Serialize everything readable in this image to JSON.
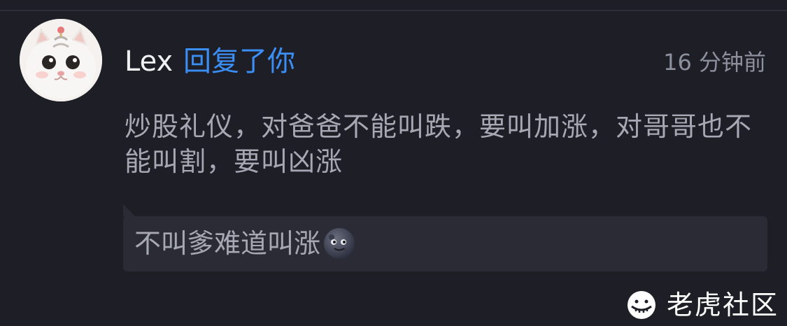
{
  "comment": {
    "username": "Lex",
    "action": "回复了你",
    "time": "16 分钟前",
    "body": "炒股礼仪，对爸爸不能叫跌，要叫加涨，对哥哥也不能叫割，要叫凶涨",
    "quote": "不叫爹难道叫涨",
    "quote_emoji": "new-moon-face-icon"
  },
  "watermark": {
    "text": "老虎社区",
    "icon": "tiger-logo-icon"
  },
  "colors": {
    "background": "#1d1e26",
    "accent": "#3b8ff4",
    "username": "#f1f1f3",
    "body_text": "#a6a8b4",
    "quote_background": "#2a2b35",
    "time_text": "#8c8f9c"
  }
}
